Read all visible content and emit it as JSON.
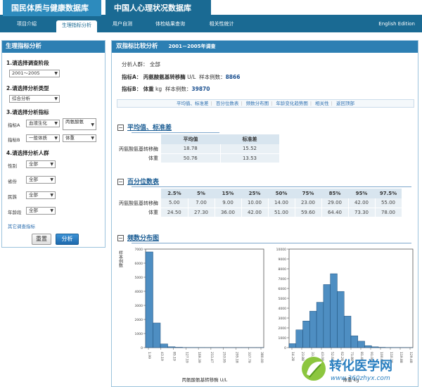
{
  "top_tabs": [
    "国民体质与健康数据库",
    "中国人心理状况数据库"
  ],
  "nav": {
    "items": [
      "项目介绍",
      "生理指标分析",
      "用户自测",
      "体检结果查询",
      "相关性统计"
    ],
    "english": "English Edition"
  },
  "sidebar": {
    "title": "生理指标分析",
    "step1": "1.请选择调查阶段",
    "stage_value": "2001～2005",
    "step2": "2.请选择分析类型",
    "type_value": "综合分析",
    "step3": "3.请选择分析指标",
    "indicatorA_label": "指标A",
    "indicatorA_cat": "血液生化",
    "indicatorA_item": "丙氨酸氨",
    "indicatorB_label": "指标B",
    "indicatorB_cat": "一般体质",
    "indicatorB_item": "体重",
    "step4": "4.请选择分析人群",
    "gender_label": "性别",
    "gender_value": "全部",
    "province_label": "省份",
    "province_value": "全部",
    "ethnic_label": "民族",
    "ethnic_value": "全部",
    "agegroup_label": "年龄段",
    "agegroup_value": "全部",
    "other_link": "其它调查指标",
    "reset_label": "重置",
    "analyze_label": "分析"
  },
  "main": {
    "title": "双指标比较分析",
    "subtitle": "2001－2005年调查",
    "population_label": "分析人群：",
    "population_value": "全部",
    "indA_label": "指标A：",
    "indA_name": "丙氨酸氨基转移酶",
    "indA_unit": "U/L",
    "indA_count_label": "样本例数：",
    "indA_count": "8866",
    "indB_label": "指标B：",
    "indB_name": "体重",
    "indB_unit": "kg",
    "indB_count_label": "样本例数：",
    "indB_count": "39870",
    "quick_links": [
      "平均值、标准差",
      "百分位数表",
      "频数分布图",
      "年龄变化趋势图",
      "相关性",
      "返回顶部"
    ]
  },
  "mean_section": {
    "title": "平均值、标准差",
    "headers": [
      "平均值",
      "标准差"
    ],
    "rows": [
      {
        "name": "丙氨酸氨基转移酶",
        "mean": "18.78",
        "sd": "15.52"
      },
      {
        "name": "体重",
        "mean": "50.76",
        "sd": "13.53"
      }
    ]
  },
  "percentile_section": {
    "title": "百分位数表",
    "headers": [
      "2.5%",
      "5%",
      "15%",
      "25%",
      "50%",
      "75%",
      "85%",
      "95%",
      "97.5%"
    ],
    "rows": [
      {
        "name": "丙氨酸氨基转移酶",
        "values": [
          "5.00",
          "7.00",
          "9.00",
          "10.00",
          "14.00",
          "23.00",
          "29.00",
          "42.00",
          "55.00"
        ]
      },
      {
        "name": "体重",
        "values": [
          "24.50",
          "27.30",
          "36.00",
          "42.00",
          "51.00",
          "59.60",
          "64.40",
          "73.30",
          "78.00"
        ]
      }
    ]
  },
  "freq_section": {
    "title": "频数分布图"
  },
  "watermark": {
    "brand": "转化医学网",
    "url": "www.360zhyx.com"
  },
  "chart_data": [
    {
      "type": "bar",
      "xlabel": "丙氨酸氨基转移酶 U/L",
      "ylabel": "样本例数",
      "ylim": [
        0,
        7000
      ],
      "yticks": [
        "0",
        "1000",
        "2000",
        "3000",
        "4000",
        "5000",
        "6000",
        "7000"
      ],
      "xticks": [
        "1.99",
        "43.19",
        "85.19",
        "127.19",
        "169.39",
        "211.47",
        "253.95",
        "295.18",
        "337.79",
        "380.00"
      ],
      "values": [
        6800,
        1750,
        260,
        60,
        25,
        12,
        8,
        5,
        3,
        2,
        2,
        1,
        1,
        1,
        1,
        1
      ]
    },
    {
      "type": "bar",
      "xlabel": "体重 kg",
      "ylabel": "",
      "ylim": [
        0,
        10000
      ],
      "yticks": [
        "0",
        "1000",
        "2000",
        "3000",
        "4000",
        "5000",
        "6000",
        "7000",
        "8000",
        "9000",
        "10000"
      ],
      "xticks": [
        "14.28",
        "23.88",
        "33.48",
        "43.08",
        "52.68",
        "62.28",
        "71.88",
        "81.48",
        "91.08",
        "100.68",
        "110.28",
        "119.88",
        "129.48"
      ],
      "values": [
        400,
        1800,
        2700,
        3700,
        4600,
        6400,
        7500,
        5700,
        3200,
        1200,
        650,
        200,
        80,
        30,
        15,
        8,
        5,
        2
      ]
    }
  ]
}
